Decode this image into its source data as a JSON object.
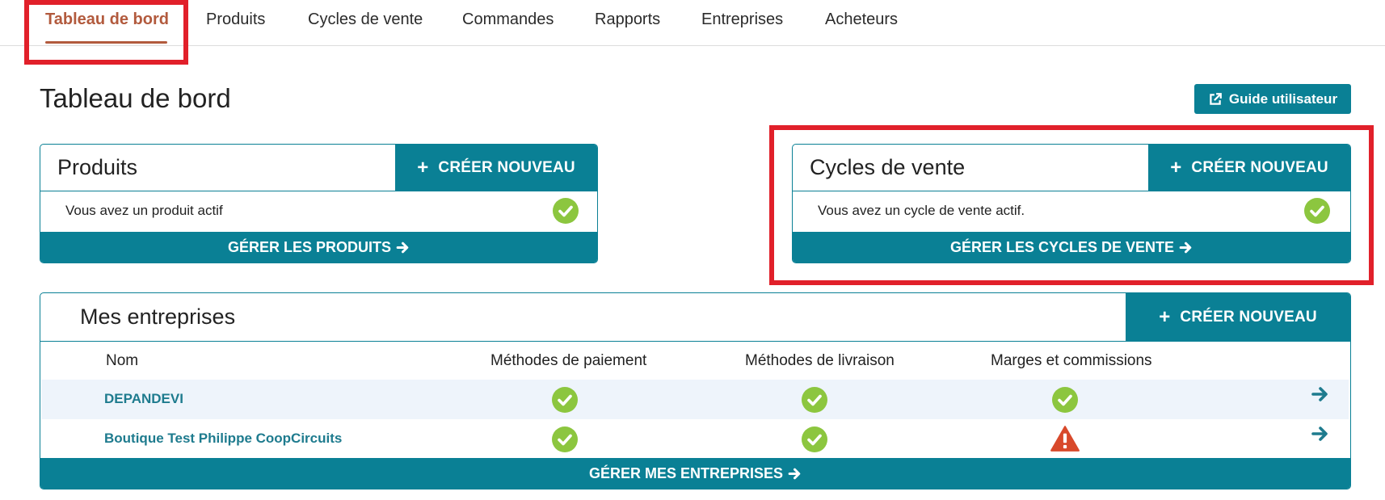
{
  "nav": {
    "items": [
      {
        "label": "Tableau de bord",
        "active": true
      },
      {
        "label": "Produits"
      },
      {
        "label": "Cycles de vente"
      },
      {
        "label": "Commandes"
      },
      {
        "label": "Rapports"
      },
      {
        "label": "Entreprises"
      },
      {
        "label": "Acheteurs"
      }
    ]
  },
  "page": {
    "title": "Tableau de bord",
    "guide_label": "Guide utilisateur"
  },
  "products_card": {
    "title": "Produits",
    "create_label": "CRÉER NOUVEAU",
    "status": "Vous avez un produit actif",
    "manage_label": "GÉRER LES PRODUITS"
  },
  "sales_cycles_card": {
    "title": "Cycles de vente",
    "create_label": "CRÉER NOUVEAU",
    "status": "Vous avez un cycle de vente actif.",
    "manage_label": "GÉRER LES CYCLES DE VENTE"
  },
  "enterprises_card": {
    "title": "Mes entreprises",
    "create_label": "CRÉER NOUVEAU",
    "columns": [
      "Nom",
      "Méthodes de paiement",
      "Méthodes de livraison",
      "Marges et commissions"
    ],
    "rows": [
      {
        "name": "DEPANDEVI",
        "payment": "ok",
        "delivery": "ok",
        "margins": "ok"
      },
      {
        "name": "Boutique Test Philippe CoopCircuits",
        "payment": "ok",
        "delivery": "ok",
        "margins": "warning"
      }
    ],
    "manage_label": "GÉRER MES ENTREPRISES"
  },
  "colors": {
    "primary": "#0a8095",
    "active_nav": "#b25a3d",
    "check_green": "#8cc63f",
    "warning_red": "#d8492b",
    "highlight_red": "#e1202a",
    "row_alt": "#eef4fb"
  },
  "icons": {
    "check": "check-circle-icon",
    "warning": "warning-triangle-icon",
    "arrow": "arrow-right-icon",
    "external": "external-link-icon",
    "plus": "plus-icon"
  }
}
